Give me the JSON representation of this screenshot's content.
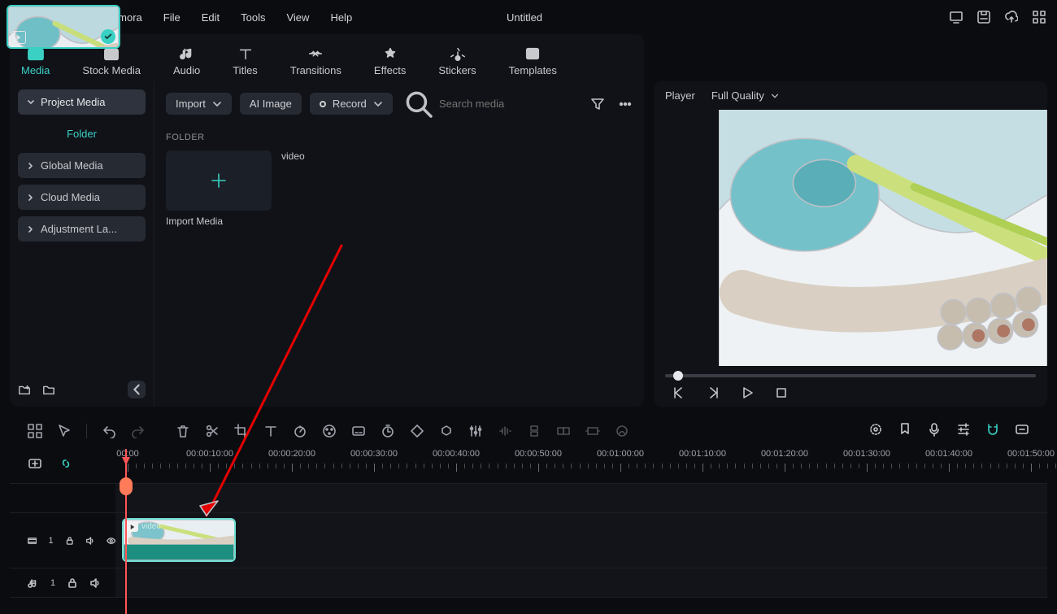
{
  "app": {
    "name": "Wondershare Filmora",
    "document": "Untitled"
  },
  "menus": [
    "File",
    "Edit",
    "Tools",
    "View",
    "Help"
  ],
  "tabs": [
    {
      "id": "media",
      "label": "Media",
      "active": true
    },
    {
      "id": "stock",
      "label": "Stock Media"
    },
    {
      "id": "audio",
      "label": "Audio"
    },
    {
      "id": "titles",
      "label": "Titles"
    },
    {
      "id": "transitions",
      "label": "Transitions"
    },
    {
      "id": "effects",
      "label": "Effects"
    },
    {
      "id": "stickers",
      "label": "Stickers"
    },
    {
      "id": "templates",
      "label": "Templates"
    }
  ],
  "sidebar": {
    "items": [
      {
        "label": "Project Media",
        "active": true
      },
      {
        "label": "Folder",
        "folder": true
      },
      {
        "label": "Global Media"
      },
      {
        "label": "Cloud Media"
      },
      {
        "label": "Adjustment La..."
      }
    ]
  },
  "toolbar": {
    "import": "Import",
    "ai_image": "AI Image",
    "record": "Record",
    "search_placeholder": "Search media"
  },
  "folder_section": {
    "title": "FOLDER",
    "import_label": "Import Media",
    "clip_label": "video"
  },
  "player": {
    "title": "Player",
    "quality": "Full Quality"
  },
  "timeline": {
    "timestamps": [
      "00:00",
      "00:00:10:00",
      "00:00:20:00",
      "00:00:30:00",
      "00:00:40:00",
      "00:00:50:00",
      "00:01:00:00",
      "00:01:10:00",
      "00:01:20:00",
      "00:01:30:00",
      "00:01:40:00",
      "00:01:50:00"
    ],
    "video_track": "1",
    "audio_track": "1",
    "clip_label": "video"
  }
}
